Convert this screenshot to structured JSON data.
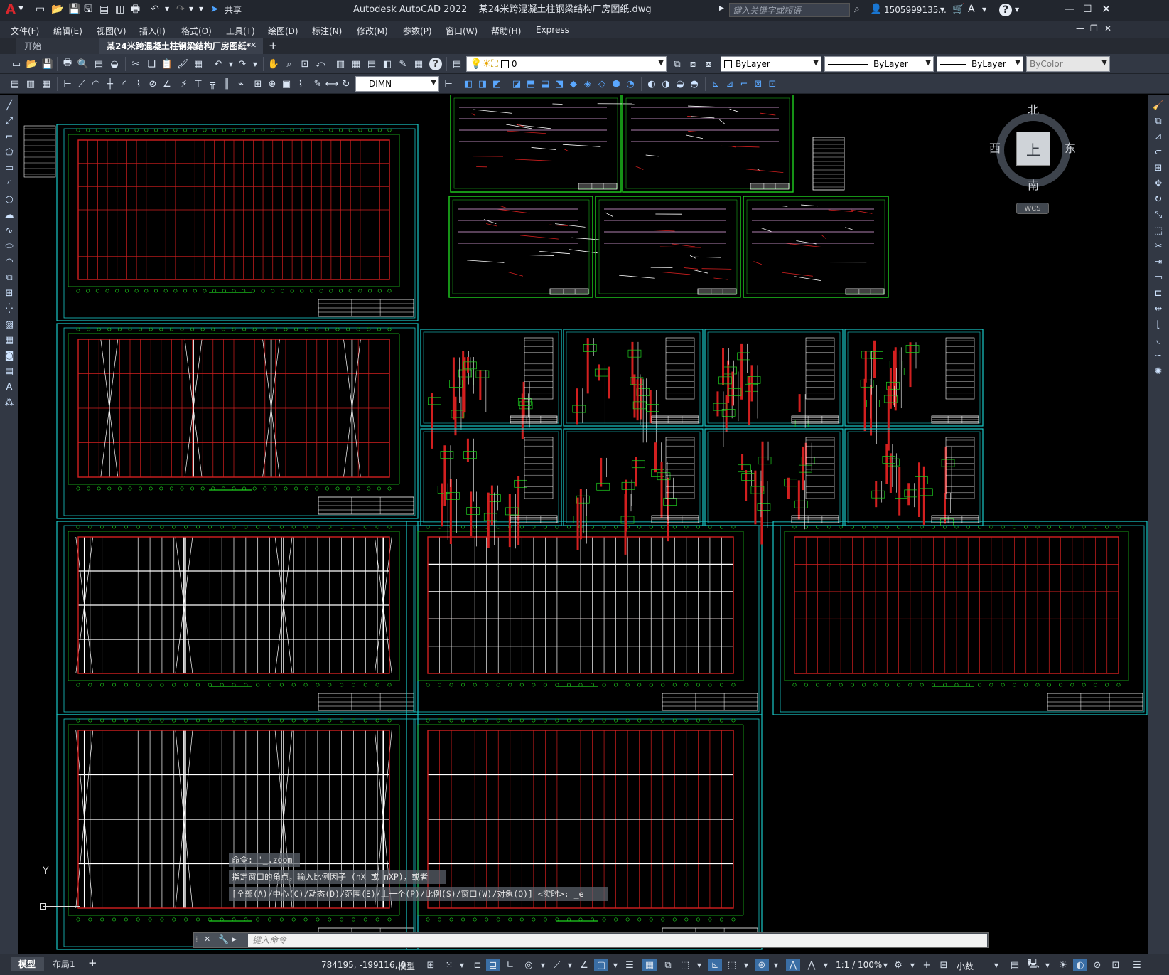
{
  "title_bar": {
    "app_logo": "A",
    "share_label": "共享",
    "window_title": "Autodesk AutoCAD 2022    某24米跨混凝土柱钢梁结构厂房图纸.dwg",
    "search_placeholder": "键入关键字或短语",
    "user": "1505999135...",
    "icons": [
      "autocad-logo-icon",
      "new-icon",
      "open-icon",
      "save-icon",
      "saveas-icon",
      "web-mobile-icon",
      "plot-icon",
      "undo-icon",
      "redo-icon",
      "share-icon",
      "search-icon",
      "user-icon",
      "cart-icon",
      "help-icon",
      "minimize-icon",
      "maximize-icon",
      "close-icon"
    ]
  },
  "menu": [
    "文件(F)",
    "编辑(E)",
    "视图(V)",
    "插入(I)",
    "格式(O)",
    "工具(T)",
    "绘图(D)",
    "标注(N)",
    "修改(M)",
    "参数(P)",
    "窗口(W)",
    "帮助(H)",
    "Express"
  ],
  "tabs": [
    {
      "label": "开始"
    },
    {
      "label": "某24米跨混凝土柱钢梁结构厂房图纸*"
    }
  ],
  "layer_toolbar": {
    "layer_name": "0",
    "color": "ByLayer",
    "linetype": "ByLayer",
    "lineweight": "ByLayer",
    "plotstyle": "ByColor"
  },
  "dim_toolbar": {
    "dimstyle": "DIMN"
  },
  "viewcube": {
    "north": "北",
    "south": "南",
    "east": "东",
    "west": "西",
    "top_face": "上",
    "wcs": "WCS"
  },
  "ucs": {
    "y_label": "Y"
  },
  "command": {
    "history": [
      "命令: '_.zoom",
      "指定窗口的角点，输入比例因子 (nX 或 nXP)，或者",
      "[全部(A)/中心(C)/动态(D)/范围(E)/上一个(P)/比例(S)/窗口(W)/对象(O)] <实时>: _e"
    ],
    "placeholder": "键入命令"
  },
  "status": {
    "model_tab": "模型",
    "layout_tab": "布局1",
    "coords": "784195, -199116, 0",
    "mode": "模型",
    "scale": "1:1 / 100%",
    "units": "小数"
  },
  "colors": {
    "accent": "#3a6ea5",
    "sheet_border": "#19c8c8",
    "plot_frame": "#1fd11f",
    "grid_red": "#d21f1f",
    "bg": "#000000"
  }
}
